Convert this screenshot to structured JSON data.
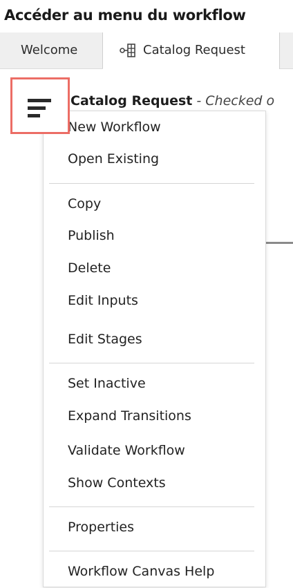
{
  "heading": "Accéder au menu du workflow",
  "tabs": [
    {
      "label": "Welcome"
    },
    {
      "label": "Catalog Request",
      "icon": "workflow-icon"
    }
  ],
  "document": {
    "title": "Catalog Request",
    "status": "- Checked o"
  },
  "menu_button": {
    "icon": "hamburger-menu-icon",
    "highlight_color": "#ec6d65"
  },
  "menu": {
    "items": [
      "New Workflow",
      "Open Existing",
      "Copy",
      "Publish",
      "Delete",
      "Edit Inputs",
      "Edit Stages",
      "Set Inactive",
      "Expand Transitions",
      "Validate Workflow",
      "Show Contexts",
      "Properties",
      "Workflow Canvas Help"
    ]
  }
}
